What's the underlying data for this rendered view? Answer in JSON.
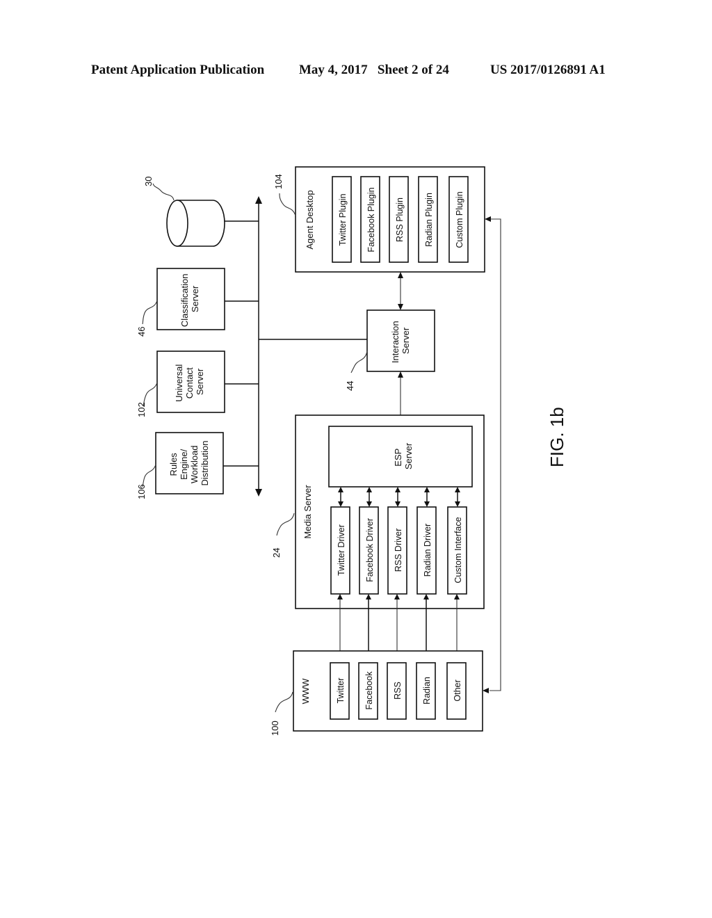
{
  "header": {
    "left": "Patent Application Publication",
    "date_sheet": "May 4, 2017   Sheet 2 of 24",
    "pub_number": "US 2017/0126891 A1"
  },
  "figure_label": "FIG. 1b",
  "nodes": {
    "database": {
      "ref": "30"
    },
    "classification_server": {
      "ref": "46",
      "lines": [
        "Classification",
        "Server"
      ]
    },
    "universal_contact_server": {
      "ref": "102",
      "lines": [
        "Universal",
        "Contact",
        "Server"
      ]
    },
    "rules_engine": {
      "ref": "106",
      "lines": [
        "Rules",
        "Engine/",
        "Workload",
        "Distribution"
      ]
    },
    "agent_desktop": {
      "ref": "104",
      "title": "Agent Desktop",
      "items": [
        "Twitter Plugin",
        "Facebook Plugin",
        "RSS Plugin",
        "Radian Plugin",
        "Custom Plugin"
      ]
    },
    "interaction_server": {
      "ref": "44",
      "lines": [
        "Interaction",
        "Server"
      ]
    },
    "media_server": {
      "ref": "24",
      "title": "Media Server",
      "esp_lines": [
        "ESP",
        "Server"
      ],
      "items": [
        "Twitter Driver",
        "Facebook Driver",
        "RSS Driver",
        "Radian Driver",
        "Custom Interface"
      ]
    },
    "www": {
      "ref": "100",
      "title": "WWW",
      "items": [
        "Twitter",
        "Facebook",
        "RSS",
        "Radian",
        "Other"
      ]
    }
  }
}
